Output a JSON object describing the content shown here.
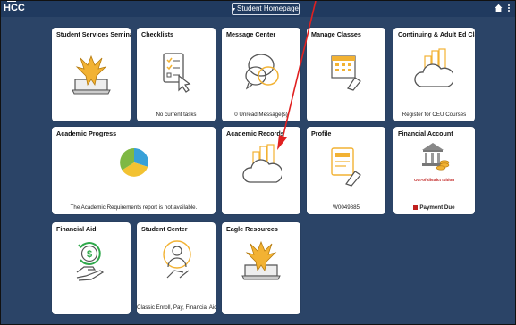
{
  "header": {
    "logo": "HCC",
    "title": "Student Homepage",
    "title_caret": "▾",
    "home_icon": "home-icon",
    "more_icon": "more-vertical-icon"
  },
  "tiles": [
    {
      "key": "student-services-seminar",
      "title": "Student Services Seminar",
      "subtitle": "",
      "icon": "eagle-laptop-icon"
    },
    {
      "key": "checklists",
      "title": "Checklists",
      "subtitle": "No current tasks",
      "icon": "checklist-cursor-icon"
    },
    {
      "key": "message-center",
      "title": "Message Center",
      "subtitle": "0 Unread Message(s)",
      "icon": "chat-bubbles-icon"
    },
    {
      "key": "manage-classes",
      "title": "Manage Classes",
      "subtitle": "",
      "icon": "calendar-hand-icon"
    },
    {
      "key": "continuing-adult-ed",
      "title": "Continuing & Adult Ed Classes",
      "subtitle": "Register for CEU Courses",
      "icon": "cloud-buildings-icon"
    },
    {
      "key": "academic-progress",
      "title": "Academic Progress",
      "subtitle": "The Academic Requirements report is not available.",
      "icon": "pie-chart-icon"
    },
    {
      "key": "academic-records",
      "title": "Academic Records",
      "subtitle": "",
      "icon": "cloud-buildings-icon"
    },
    {
      "key": "profile",
      "title": "Profile",
      "subtitle": "W0049885",
      "icon": "id-card-hand-icon"
    },
    {
      "key": "financial-account",
      "title": "Financial Account",
      "subtitle": "Payment Due",
      "icon": "bank-coins-icon",
      "badge": "Out-of-district tuition"
    },
    {
      "key": "financial-aid",
      "title": "Financial Aid",
      "subtitle": "",
      "icon": "dollar-hand-icon"
    },
    {
      "key": "student-center",
      "title": "Student Center",
      "subtitle": "Classic Enroll, Pay, Financial Aid etc",
      "icon": "person-gear-icon"
    },
    {
      "key": "eagle-resources",
      "title": "Eagle Resources",
      "subtitle": "",
      "icon": "eagle-laptop-icon"
    }
  ],
  "colors": {
    "background": "#2b4467",
    "topbar": "#203a5f",
    "accent_gold": "#f2b233",
    "annotation_arrow": "#e02020",
    "alert_red": "#c0201e"
  }
}
